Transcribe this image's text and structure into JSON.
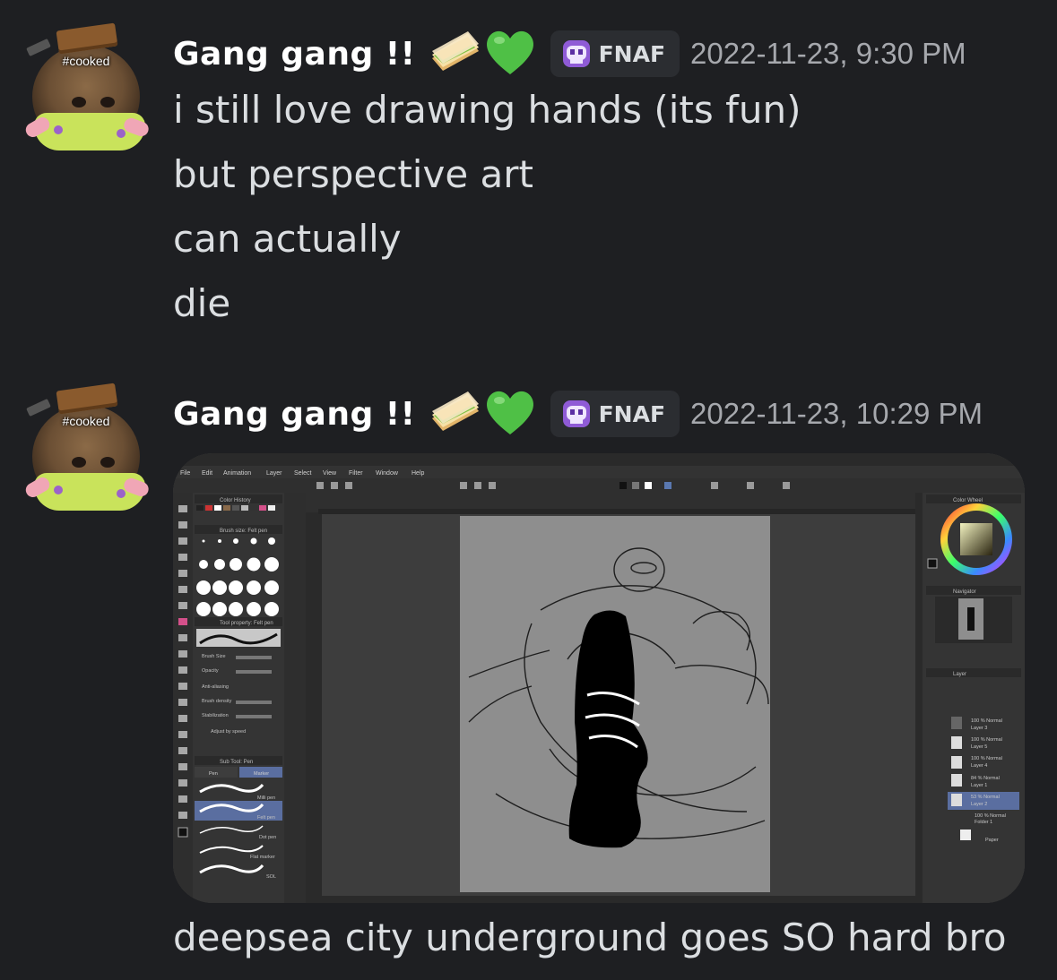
{
  "messages": [
    {
      "author": "Gang gang !!",
      "avatar_tag": "#cooked",
      "author_emojis": [
        "sandwich-emoji",
        "green-heart-emoji"
      ],
      "clan_tag": "FNAF",
      "clan_icon": "purple-skull-icon",
      "timestamp": "2022-11-23, 9:30 PM",
      "lines": [
        "i still love drawing hands (its fun)",
        "but perspective art",
        "can actually",
        "die"
      ]
    },
    {
      "author": "Gang gang !!",
      "avatar_tag": "#cooked",
      "author_emojis": [
        "sandwich-emoji",
        "green-heart-emoji"
      ],
      "clan_tag": "FNAF",
      "clan_icon": "purple-skull-icon",
      "timestamp": "2022-11-23, 10:29 PM",
      "attachment": {
        "type": "screenshot",
        "app_menu": [
          "File",
          "Edit",
          "Animation",
          "Layer",
          "Select",
          "View",
          "Filter",
          "Window",
          "Help"
        ],
        "palette_labels": [
          "Color History",
          "Brush size: Felt pen",
          "Tool property: Felt pen",
          "Sub Tool: Pen",
          "Color Wheel",
          "Navigator",
          "Layer"
        ],
        "sub_tools": [
          "Pen",
          "Marker",
          "Milli pen",
          "Felt pen",
          "Dot pen",
          "Flat marker",
          "SOL"
        ],
        "tool_properties": [
          "Brush Size",
          "Opacity",
          "Anti-aliasing",
          "Brush density",
          "Stabilization",
          "Adjust by speed"
        ],
        "layers": [
          "Layer 3",
          "Layer 5",
          "Layer 4",
          "Layer 1",
          "Layer 2",
          "Folder 1",
          "Paper"
        ]
      },
      "lines": [
        "deepsea city underground goes SO hard bro"
      ]
    }
  ],
  "colors": {
    "background": "#1e1f22",
    "username": "#ffffff",
    "text": "#dbdee1",
    "timestamp": "#a6a8ad",
    "clan_tag_bg": "#2b2d31"
  }
}
